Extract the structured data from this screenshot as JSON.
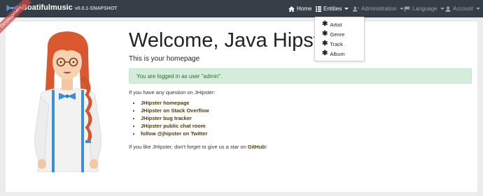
{
  "brand": {
    "name": "Boatifulmusic",
    "version": "v0.0.1-SNAPSHOT"
  },
  "nav": {
    "home": "Home",
    "entities": "Entities",
    "administration": "Administration",
    "language": "Language",
    "account": "Account"
  },
  "ribbon": "Development",
  "entities_menu": [
    "Artist",
    "Genre",
    "Track",
    "Album"
  ],
  "home": {
    "title": "Welcome, Java Hipster!",
    "subtitle": "This is your homepage",
    "alert": "You are logged in as user \"admin\".",
    "question": "If you have any question on JHipster:",
    "links": [
      "JHipster homepage",
      "JHipster on Stack Overflow",
      "JHipster bug tracker",
      "JHipster public chat room",
      "follow @jhipster on Twitter"
    ],
    "star_prefix": "If you like JHipster, don't forget to give us a star on ",
    "star_link": "GitHub",
    "star_suffix": "!"
  },
  "colors": {
    "navbar": "#353d47",
    "alert_bg": "#d5eddb",
    "alert_text": "#2b6b3a",
    "link": "#4e3d07",
    "ribbon": "#d24646"
  }
}
